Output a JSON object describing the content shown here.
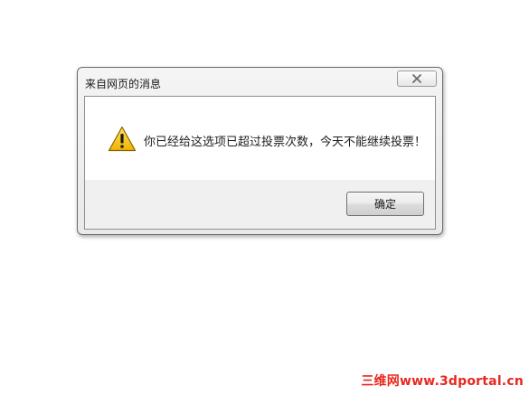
{
  "dialog": {
    "title": "来自网页的消息",
    "close_icon": "close-icon",
    "warning_icon": "warning-icon",
    "message": "你已经给这选项已超过投票次数，今天不能继续投票！",
    "ok_label": "确定"
  },
  "watermark": {
    "text": "三维网www.3dportal.cn",
    "color": "#e8281e"
  },
  "colors": {
    "close_x": "#6b6b6b",
    "warning_fill": "#f5c400",
    "warning_border": "#7a5a00"
  }
}
